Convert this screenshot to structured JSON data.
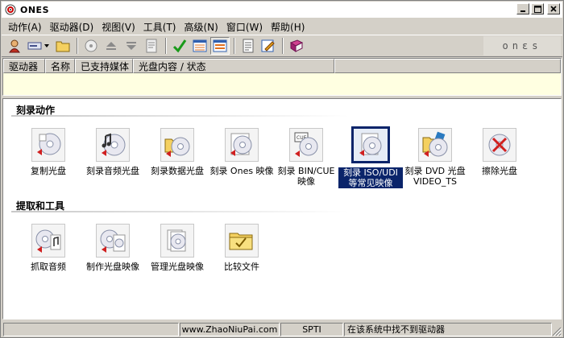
{
  "window": {
    "title": "ONES"
  },
  "menu": [
    "动作(A)",
    "驱动器(D)",
    "视图(V)",
    "工具(T)",
    "高级(N)",
    "窗口(W)",
    "帮助(H)"
  ],
  "toolbar": {
    "icons": [
      "burn-wizard-icon",
      "drive-select-icon",
      "open-folder-icon",
      "drive-info-icon",
      "eject-icon",
      "load-tray-icon",
      "properties-icon",
      "check-icon",
      "view-list-icon",
      "view-icons-icon",
      "notes-icon",
      "edit-icon",
      "help-book-icon"
    ],
    "brand": "onεs"
  },
  "drives": {
    "columns": [
      "驱动器",
      "名称",
      "已支持媒体",
      "光盘内容 / 状态"
    ]
  },
  "sections": {
    "burn": {
      "title": "刻录动作",
      "items": [
        {
          "label": "复制光盘",
          "icon": "copy-disc-icon"
        },
        {
          "label": "刻录音频光盘",
          "icon": "audio-disc-icon"
        },
        {
          "label": "刻录数据光盘",
          "icon": "data-disc-icon"
        },
        {
          "label": "刻录 Ones 映像",
          "icon": "ones-image-icon"
        },
        {
          "label": "刻录 BIN/CUE 映像",
          "icon": "bin-cue-icon"
        },
        {
          "label": "刻录 ISO/UDI 等常见映像",
          "icon": "iso-image-icon",
          "selected": true
        },
        {
          "label": "刻录 DVD 光盘 VIDEO_TS",
          "icon": "dvd-video-icon"
        },
        {
          "label": "擦除光盘",
          "icon": "erase-disc-icon"
        }
      ]
    },
    "extract": {
      "title": "提取和工具",
      "items": [
        {
          "label": "抓取音频",
          "icon": "rip-audio-icon"
        },
        {
          "label": "制作光盘映像",
          "icon": "make-image-icon"
        },
        {
          "label": "管理光盘映像",
          "icon": "manage-images-icon"
        },
        {
          "label": "比较文件",
          "icon": "compare-files-icon"
        }
      ]
    }
  },
  "status": {
    "watermark": "www.ZhaoNiuPai.com",
    "interface": "SPTI",
    "message": "在该系统中找不到驱动器"
  },
  "colors": {
    "selection": "#0a246a",
    "chrome": "#d4d0c8",
    "drive_list_bg": "#ffffe1"
  }
}
